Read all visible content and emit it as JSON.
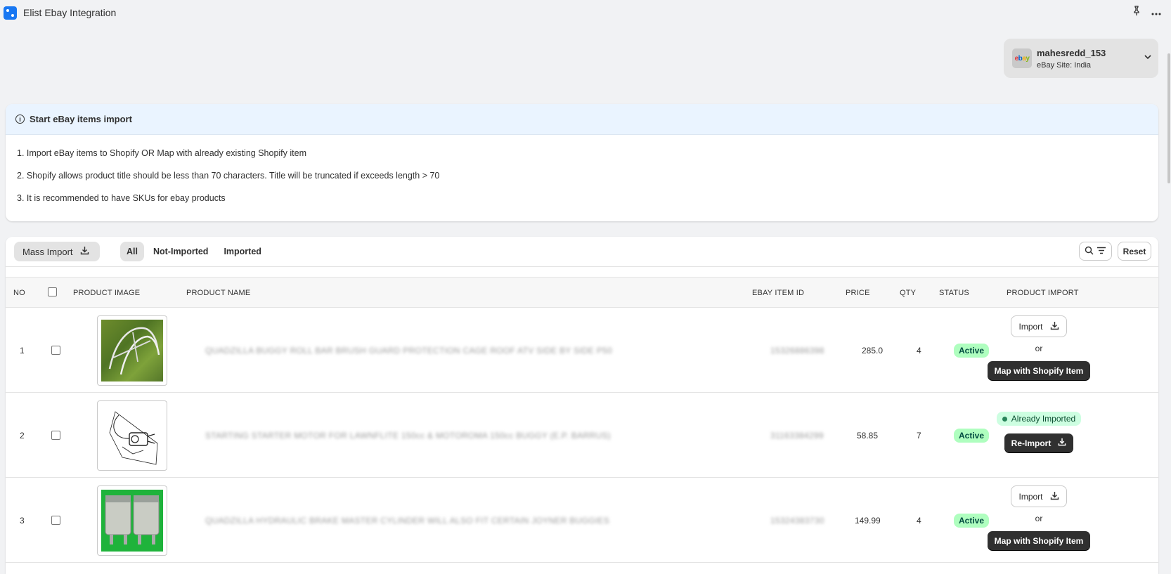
{
  "app": {
    "title": "Elist Ebay Integration"
  },
  "topbar": {
    "pin_icon": "pin-icon",
    "more_icon": "more-icon"
  },
  "account": {
    "name": "mahesredd_153",
    "site": "eBay Site: India",
    "logo_letters": [
      "e",
      "b",
      "a",
      "y"
    ]
  },
  "banner": {
    "title": "Start eBay items import",
    "items": [
      "1. Import eBay items to Shopify OR Map with already existing Shopify item",
      "2. Shopify allows product title should be less than 70 characters. Title will be truncated if exceeds length > 70",
      "3. It is recommended to have SKUs for ebay products"
    ]
  },
  "toolbar": {
    "mass_import": "Mass Import",
    "tabs": [
      "All",
      "Not-Imported",
      "Imported"
    ],
    "active_tab": "All",
    "reset": "Reset"
  },
  "table": {
    "headers": {
      "no": "NO",
      "image": "PRODUCT IMAGE",
      "name": "PRODUCT NAME",
      "item_id": "EBAY ITEM ID",
      "price": "PRICE",
      "qty": "QTY",
      "status": "STATUS",
      "import": "PRODUCT IMPORT"
    },
    "rows": [
      {
        "no": "1",
        "name": "QUADZILLA BUGGY ROLL BAR BRUSH GUARD PROTECTION CAGE ROOF ATV SIDE BY SIDE P50",
        "item_id": "15326886398",
        "price": "285.0",
        "qty": "4",
        "status": "Active",
        "import_label": "Import",
        "or_label": "or",
        "map_label": "Map with Shopify Item"
      },
      {
        "no": "2",
        "name": "STARTING STARTER MOTOR FOR LAWNFLITE 150cc & MOTOROMA 150cc BUGGY (E.P. BARRUS)",
        "item_id": "31163384299",
        "price": "58.85",
        "qty": "7",
        "status": "Active",
        "already_label": "Already Imported",
        "reimport_label": "Re-Import"
      },
      {
        "no": "3",
        "name": "QUADZILLA HYDRAULIC BRAKE MASTER CYLINDER WILL ALSO FIT CERTAIN JOYNER BUGGIES",
        "item_id": "15324383730",
        "price": "149.99",
        "qty": "4",
        "status": "Active",
        "import_label": "Import",
        "or_label": "or",
        "map_label": "Map with Shopify Item"
      }
    ]
  }
}
